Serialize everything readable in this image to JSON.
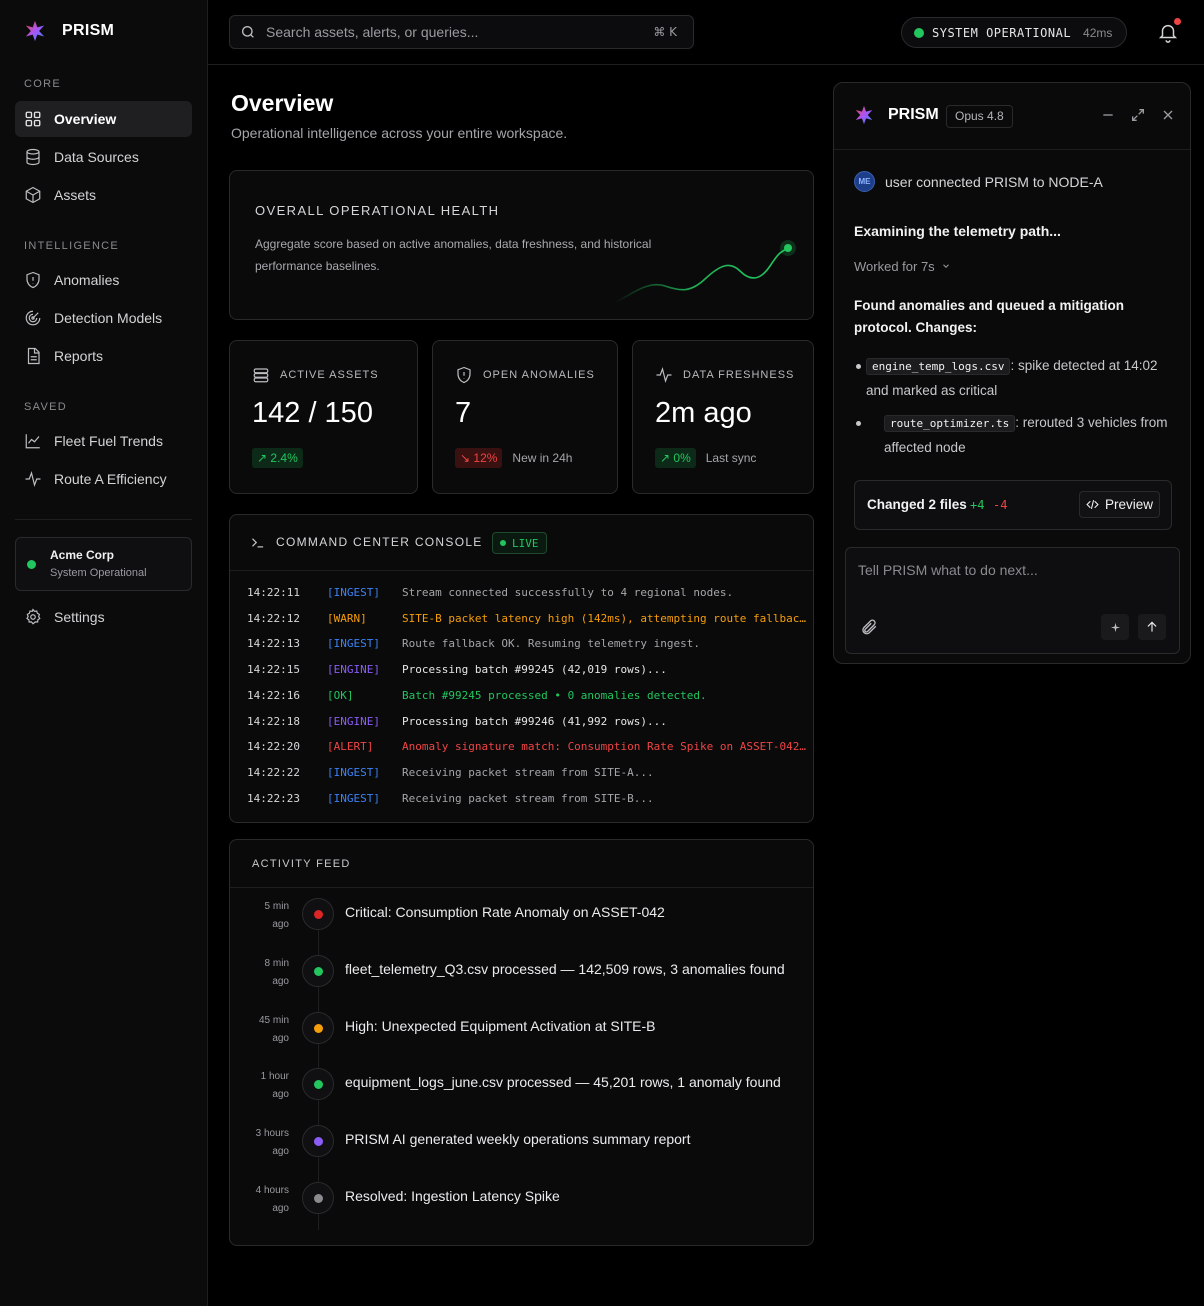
{
  "app": {
    "name": "PRISM"
  },
  "sidebar": {
    "sections": [
      {
        "title": "CORE",
        "items": [
          {
            "label": "Overview",
            "icon": "grid-icon",
            "active": true
          },
          {
            "label": "Data Sources",
            "icon": "database-icon"
          },
          {
            "label": "Assets",
            "icon": "cube-icon"
          }
        ]
      },
      {
        "title": "INTELLIGENCE",
        "items": [
          {
            "label": "Anomalies",
            "icon": "shield-icon"
          },
          {
            "label": "Detection Models",
            "icon": "radar-icon"
          },
          {
            "label": "Reports",
            "icon": "document-icon"
          }
        ]
      },
      {
        "title": "SAVED",
        "items": [
          {
            "label": "Fleet Fuel Trends",
            "icon": "line-chart-icon"
          },
          {
            "label": "Route A Efficiency",
            "icon": "pulse-icon"
          }
        ]
      }
    ],
    "org": {
      "name": "Acme Corp",
      "status": "System Operational"
    },
    "settings_label": "Settings"
  },
  "topbar": {
    "search_placeholder": "Search assets, alerts, or queries...",
    "shortcut": "⌘ K",
    "system_status": "SYSTEM OPERATIONAL",
    "latency": "42ms"
  },
  "main": {
    "title": "Overview",
    "subtitle": "Operational intelligence across your entire workspace.",
    "health": {
      "title": "OVERALL OPERATIONAL HEALTH",
      "description": "Aggregate score based on active anomalies, data freshness, and historical performance baselines."
    },
    "kpis": [
      {
        "label": "ACTIVE ASSETS",
        "value": "142 / 150",
        "delta": "↗ 2.4%",
        "note": ""
      },
      {
        "label": "OPEN ANOMALIES",
        "value": "7",
        "delta": "↘ 12%",
        "note": "New in 24h"
      },
      {
        "label": "DATA FRESHNESS",
        "value": "2m ago",
        "delta": "↗ 0%",
        "note": "Last sync"
      }
    ],
    "console": {
      "title": "COMMAND CENTER CONSOLE",
      "badge": "LIVE",
      "logs": [
        {
          "time": "14:22:11",
          "tag": "[INGEST]",
          "msg": "Stream connected successfully to 4 regional nodes.",
          "level": "ingest"
        },
        {
          "time": "14:22:12",
          "tag": "[WARN]",
          "msg": "SITE-B packet latency high (142ms), attempting route fallback...",
          "level": "warn"
        },
        {
          "time": "14:22:13",
          "tag": "[INGEST]",
          "msg": "Route fallback OK. Resuming telemetry ingest.",
          "level": "ingest"
        },
        {
          "time": "14:22:15",
          "tag": "[ENGINE]",
          "msg": "Processing batch #99245 (42,019 rows)...",
          "level": "engine"
        },
        {
          "time": "14:22:16",
          "tag": "[OK]",
          "msg": "Batch #99245 processed • 0 anomalies detected.",
          "level": "ok"
        },
        {
          "time": "14:22:18",
          "tag": "[ENGINE]",
          "msg": "Processing batch #99246 (41,992 rows)...",
          "level": "engine"
        },
        {
          "time": "14:22:20",
          "tag": "[ALERT]",
          "msg": "Anomaly signature match: Consumption Rate Spike on ASSET-042. T...",
          "level": "alert"
        },
        {
          "time": "14:22:22",
          "tag": "[INGEST]",
          "msg": "Receiving packet stream from SITE-A...",
          "level": "ingest"
        },
        {
          "time": "14:22:23",
          "tag": "[INGEST]",
          "msg": "Receiving packet stream from SITE-B...",
          "level": "ingest"
        }
      ]
    },
    "feed": {
      "title": "ACTIVITY FEED",
      "items": [
        {
          "time1": "5 min",
          "time2": "ago",
          "text": "Critical: Consumption Rate Anomaly on ASSET-042",
          "color": "#dc2626"
        },
        {
          "time1": "8 min",
          "time2": "ago",
          "text": "fleet_telemetry_Q3.csv processed — 142,509 rows, 3 anomalies found",
          "color": "#22c55e"
        },
        {
          "time1": "45 min",
          "time2": "ago",
          "text": "High: Unexpected Equipment Activation at SITE-B",
          "color": "#f59e0b"
        },
        {
          "time1": "1 hour",
          "time2": "ago",
          "text": "equipment_logs_june.csv processed — 45,201 rows, 1 anomaly found",
          "color": "#22c55e"
        },
        {
          "time1": "3 hours",
          "time2": "ago",
          "text": "PRISM AI generated weekly operations summary report",
          "color": "#8b5cf6"
        },
        {
          "time1": "4 hours",
          "time2": "ago",
          "text": "Resolved: Ingestion Latency Spike",
          "color": "#8a8a8f"
        }
      ]
    }
  },
  "panel": {
    "name": "PRISM",
    "model": "Opus 4.8",
    "avatar": "ME",
    "user_msg": "user connected PRISM to NODE-A",
    "status": "Examining the telemetry path...",
    "worked": "Worked for 7s",
    "found": "Found anomalies and queued a mitigation protocol. Changes:",
    "changes": [
      {
        "file": "engine_temp_logs.csv",
        "desc1": ": spike detected at 14:02",
        "desc2": "and marked as critical"
      },
      {
        "file": "route_optimizer.ts",
        "desc1": ": rerouted 3 vehicles from",
        "desc2": "affected node"
      }
    ],
    "changed_files": "Changed 2 files",
    "plus": "+4",
    "minus": "-4",
    "preview": "Preview",
    "composer_placeholder": "Tell PRISM what to do next..."
  },
  "colors": {
    "green": "#22c55e",
    "red": "#ef4444",
    "orange": "#f59e0b",
    "blue": "#3b82f6",
    "purple": "#8b5cf6",
    "accent_star": "#7c3aed"
  }
}
